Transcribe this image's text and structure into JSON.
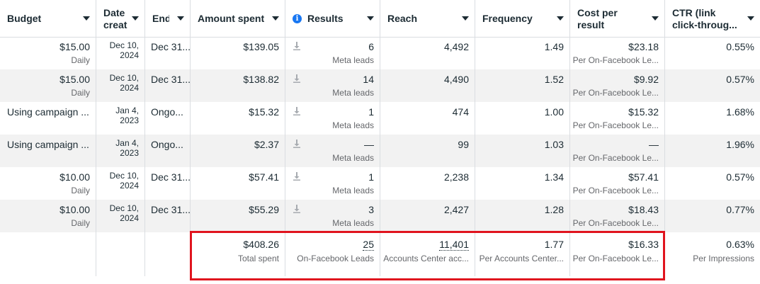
{
  "columns": {
    "budget": "Budget",
    "date_created": "Date creat",
    "ends": "Ends",
    "amount_spent": "Amount spent",
    "results": "Results",
    "reach": "Reach",
    "frequency": "Frequency",
    "cost_per_result": "Cost per result",
    "ctr": "CTR (link click-throug..."
  },
  "rows": [
    {
      "budget": "$15.00",
      "budget_sub": "Daily",
      "date_line1": "Dec 10,",
      "date_line2": "2024",
      "ends": "Dec 31...",
      "amount": "$139.05",
      "results": "6",
      "results_sub": "Meta leads",
      "reach": "4,492",
      "frequency": "1.49",
      "cost": "$23.18",
      "cost_sub": "Per On-Facebook Le...",
      "ctr": "0.55%"
    },
    {
      "budget": "$15.00",
      "budget_sub": "Daily",
      "date_line1": "Dec 10,",
      "date_line2": "2024",
      "ends": "Dec 31...",
      "amount": "$138.82",
      "results": "14",
      "results_sub": "Meta leads",
      "reach": "4,490",
      "frequency": "1.52",
      "cost": "$9.92",
      "cost_sub": "Per On-Facebook Le...",
      "ctr": "0.57%"
    },
    {
      "budget": "Using campaign ...",
      "budget_sub": "",
      "date_line1": "Jan 4,",
      "date_line2": "2023",
      "ends": "Ongo...",
      "amount": "$15.32",
      "results": "1",
      "results_sub": "Meta leads",
      "reach": "474",
      "frequency": "1.00",
      "cost": "$15.32",
      "cost_sub": "Per On-Facebook Le...",
      "ctr": "1.68%"
    },
    {
      "budget": "Using campaign ...",
      "budget_sub": "",
      "date_line1": "Jan 4,",
      "date_line2": "2023",
      "ends": "Ongo...",
      "amount": "$2.37",
      "results": "—",
      "results_sub": "Meta leads",
      "reach": "99",
      "frequency": "1.03",
      "cost": "—",
      "cost_sub": "Per On-Facebook Le...",
      "ctr": "1.96%"
    },
    {
      "budget": "$10.00",
      "budget_sub": "Daily",
      "date_line1": "Dec 10,",
      "date_line2": "2024",
      "ends": "Dec 31...",
      "amount": "$57.41",
      "results": "1",
      "results_sub": "Meta leads",
      "reach": "2,238",
      "frequency": "1.34",
      "cost": "$57.41",
      "cost_sub": "Per On-Facebook Le...",
      "ctr": "0.57%"
    },
    {
      "budget": "$10.00",
      "budget_sub": "Daily",
      "date_line1": "Dec 10,",
      "date_line2": "2024",
      "ends": "Dec 31...",
      "amount": "$55.29",
      "results": "3",
      "results_sub": "Meta leads",
      "reach": "2,427",
      "frequency": "1.28",
      "cost": "$18.43",
      "cost_sub": "Per On-Facebook Le...",
      "ctr": "0.77%"
    }
  ],
  "totals": {
    "amount": "$408.26",
    "amount_sub": "Total spent",
    "results": "25",
    "results_sub": "On-Facebook Leads",
    "reach": "11,401",
    "reach_sub": "Accounts Center acc...",
    "frequency": "1.77",
    "frequency_sub": "Per Accounts Center...",
    "cost": "$16.33",
    "cost_sub": "Per On-Facebook Le...",
    "ctr": "0.63%",
    "ctr_sub": "Per Impressions"
  },
  "icons": {
    "info": "info-icon",
    "download": "download-icon",
    "sort": "caret-down-icon"
  },
  "colors": {
    "highlight": "#e0141e",
    "info": "#1877f2",
    "alt_row": "#f2f2f2"
  }
}
